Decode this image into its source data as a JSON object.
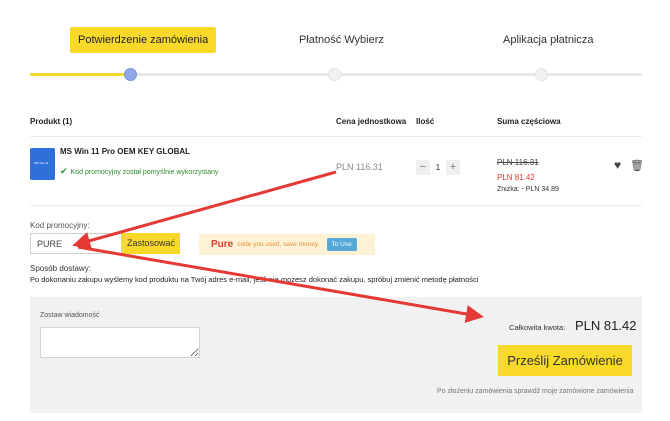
{
  "steps": [
    {
      "label": "Potwierdzenie zamówienia",
      "active": true
    },
    {
      "label": "Płatność Wybierz",
      "active": false
    },
    {
      "label": "Aplikacja płatnicza",
      "active": false
    }
  ],
  "table": {
    "headers": {
      "product": "Produkt (1)",
      "unit_price": "Cena jednostkowa",
      "quantity": "Ilość",
      "subtotal": "Suma częściowa"
    },
    "item": {
      "thumb_text": "MS Win 11",
      "name": "MS Win 11 Pro OEM KEY GLOBAL",
      "promo_status": "Kod promocyjny został pomyślnie wykorzystany",
      "unit_price": "PLN 116.31",
      "qty_minus": "−",
      "qty_value": "1",
      "qty_plus": "+",
      "price_old": "PLN 116.31",
      "price_new": "PLN 81.42",
      "discount": "Zniżka: - PLN 34.89"
    }
  },
  "promo": {
    "label": "Kod promocyjny:",
    "input_value": "PURE",
    "apply_label": "Zastosować",
    "hint_code": "Pure",
    "hint_text": "code you used, save money.",
    "hint_button": "To Use"
  },
  "shipping": {
    "label": "Sposób dostawy:",
    "text": "Po dokonaniu zakupu wyślemy kod produktu na Twój adres e-mail, jeśli nie możesz dokonać zakupu, spróbuj zmienić metodę płatności"
  },
  "summary": {
    "message_label": "Zostaw wiadomość",
    "total_label": "Całkowita kwota:",
    "total_value": "PLN 81.42",
    "submit_label": "Prześlij Zamówienie",
    "after_note": "Po złożeniu zamówienia sprawdź moje zamówione zamówienia"
  },
  "colors": {
    "accent": "#f8d92a",
    "annotation_arrow": "#e53935",
    "discount_price": "#e53935",
    "active_dot": "#8fa8ea"
  }
}
